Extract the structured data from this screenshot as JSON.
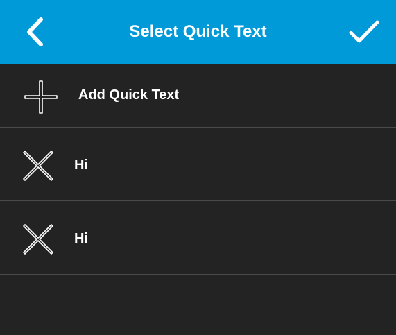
{
  "header": {
    "title": "Select Quick Text",
    "back_icon": "chevron-left-icon",
    "confirm_icon": "checkmark-icon",
    "background_color": "#009ad9"
  },
  "add_row": {
    "label": "Add Quick Text",
    "icon": "plus-icon"
  },
  "items": [
    {
      "label": "Hi",
      "icon": "delete-x-icon"
    },
    {
      "label": "Hi",
      "icon": "delete-x-icon"
    }
  ],
  "colors": {
    "background": "#232323",
    "divider": "#4a4a4a",
    "text": "#ffffff"
  }
}
